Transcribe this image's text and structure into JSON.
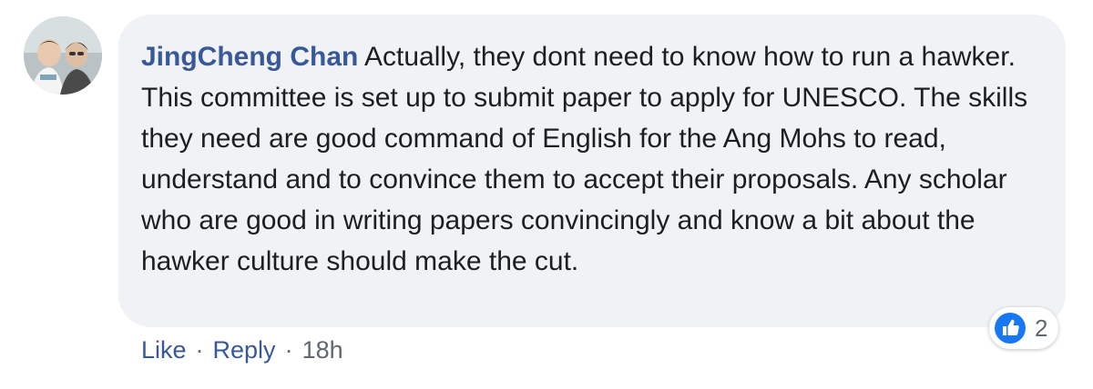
{
  "comment": {
    "author": "JingCheng Chan",
    "text": "Actually, they dont need to know how to run a hawker. This committee is set up to submit paper to apply for UNESCO. The skills they need are good command of English for the Ang Mohs to read, understand and to convince them to accept their proposals. Any scholar who are good in writing papers convincingly and know a bit about the hawker culture should make the cut."
  },
  "reactions": {
    "icon": "like-icon",
    "count": "2",
    "color": "#1877f2"
  },
  "actions": {
    "like_label": "Like",
    "reply_label": "Reply",
    "separator": "·",
    "timestamp": "18h"
  },
  "colors": {
    "author": "#385898",
    "bubble": "#f0f2f5",
    "text": "#1c1e21",
    "meta": "#606770"
  }
}
